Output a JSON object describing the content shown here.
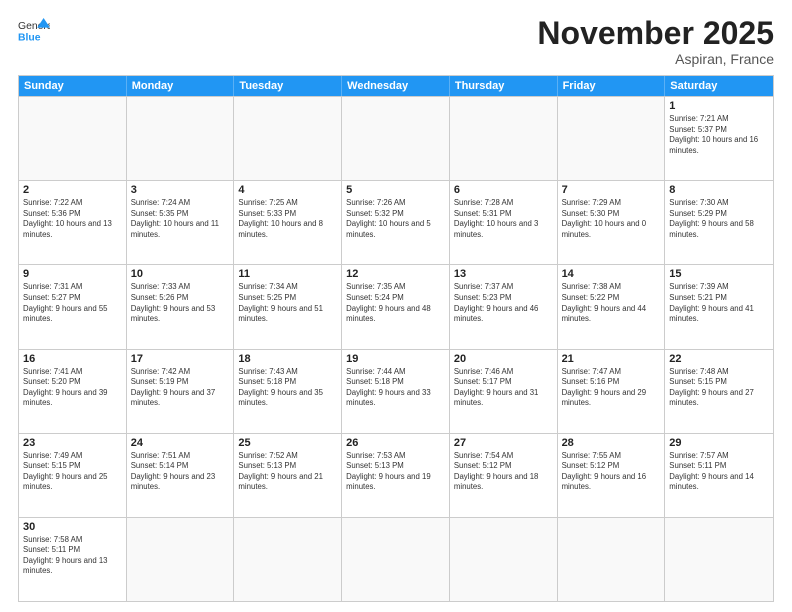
{
  "header": {
    "logo_general": "General",
    "logo_blue": "Blue",
    "month_title": "November 2025",
    "location": "Aspiran, France"
  },
  "days_of_week": [
    "Sunday",
    "Monday",
    "Tuesday",
    "Wednesday",
    "Thursday",
    "Friday",
    "Saturday"
  ],
  "weeks": [
    [
      {
        "day": "",
        "info": ""
      },
      {
        "day": "",
        "info": ""
      },
      {
        "day": "",
        "info": ""
      },
      {
        "day": "",
        "info": ""
      },
      {
        "day": "",
        "info": ""
      },
      {
        "day": "",
        "info": ""
      },
      {
        "day": "1",
        "info": "Sunrise: 7:21 AM\nSunset: 5:37 PM\nDaylight: 10 hours and 16 minutes."
      }
    ],
    [
      {
        "day": "2",
        "info": "Sunrise: 7:22 AM\nSunset: 5:36 PM\nDaylight: 10 hours and 13 minutes."
      },
      {
        "day": "3",
        "info": "Sunrise: 7:24 AM\nSunset: 5:35 PM\nDaylight: 10 hours and 11 minutes."
      },
      {
        "day": "4",
        "info": "Sunrise: 7:25 AM\nSunset: 5:33 PM\nDaylight: 10 hours and 8 minutes."
      },
      {
        "day": "5",
        "info": "Sunrise: 7:26 AM\nSunset: 5:32 PM\nDaylight: 10 hours and 5 minutes."
      },
      {
        "day": "6",
        "info": "Sunrise: 7:28 AM\nSunset: 5:31 PM\nDaylight: 10 hours and 3 minutes."
      },
      {
        "day": "7",
        "info": "Sunrise: 7:29 AM\nSunset: 5:30 PM\nDaylight: 10 hours and 0 minutes."
      },
      {
        "day": "8",
        "info": "Sunrise: 7:30 AM\nSunset: 5:29 PM\nDaylight: 9 hours and 58 minutes."
      }
    ],
    [
      {
        "day": "9",
        "info": "Sunrise: 7:31 AM\nSunset: 5:27 PM\nDaylight: 9 hours and 55 minutes."
      },
      {
        "day": "10",
        "info": "Sunrise: 7:33 AM\nSunset: 5:26 PM\nDaylight: 9 hours and 53 minutes."
      },
      {
        "day": "11",
        "info": "Sunrise: 7:34 AM\nSunset: 5:25 PM\nDaylight: 9 hours and 51 minutes."
      },
      {
        "day": "12",
        "info": "Sunrise: 7:35 AM\nSunset: 5:24 PM\nDaylight: 9 hours and 48 minutes."
      },
      {
        "day": "13",
        "info": "Sunrise: 7:37 AM\nSunset: 5:23 PM\nDaylight: 9 hours and 46 minutes."
      },
      {
        "day": "14",
        "info": "Sunrise: 7:38 AM\nSunset: 5:22 PM\nDaylight: 9 hours and 44 minutes."
      },
      {
        "day": "15",
        "info": "Sunrise: 7:39 AM\nSunset: 5:21 PM\nDaylight: 9 hours and 41 minutes."
      }
    ],
    [
      {
        "day": "16",
        "info": "Sunrise: 7:41 AM\nSunset: 5:20 PM\nDaylight: 9 hours and 39 minutes."
      },
      {
        "day": "17",
        "info": "Sunrise: 7:42 AM\nSunset: 5:19 PM\nDaylight: 9 hours and 37 minutes."
      },
      {
        "day": "18",
        "info": "Sunrise: 7:43 AM\nSunset: 5:18 PM\nDaylight: 9 hours and 35 minutes."
      },
      {
        "day": "19",
        "info": "Sunrise: 7:44 AM\nSunset: 5:18 PM\nDaylight: 9 hours and 33 minutes."
      },
      {
        "day": "20",
        "info": "Sunrise: 7:46 AM\nSunset: 5:17 PM\nDaylight: 9 hours and 31 minutes."
      },
      {
        "day": "21",
        "info": "Sunrise: 7:47 AM\nSunset: 5:16 PM\nDaylight: 9 hours and 29 minutes."
      },
      {
        "day": "22",
        "info": "Sunrise: 7:48 AM\nSunset: 5:15 PM\nDaylight: 9 hours and 27 minutes."
      }
    ],
    [
      {
        "day": "23",
        "info": "Sunrise: 7:49 AM\nSunset: 5:15 PM\nDaylight: 9 hours and 25 minutes."
      },
      {
        "day": "24",
        "info": "Sunrise: 7:51 AM\nSunset: 5:14 PM\nDaylight: 9 hours and 23 minutes."
      },
      {
        "day": "25",
        "info": "Sunrise: 7:52 AM\nSunset: 5:13 PM\nDaylight: 9 hours and 21 minutes."
      },
      {
        "day": "26",
        "info": "Sunrise: 7:53 AM\nSunset: 5:13 PM\nDaylight: 9 hours and 19 minutes."
      },
      {
        "day": "27",
        "info": "Sunrise: 7:54 AM\nSunset: 5:12 PM\nDaylight: 9 hours and 18 minutes."
      },
      {
        "day": "28",
        "info": "Sunrise: 7:55 AM\nSunset: 5:12 PM\nDaylight: 9 hours and 16 minutes."
      },
      {
        "day": "29",
        "info": "Sunrise: 7:57 AM\nSunset: 5:11 PM\nDaylight: 9 hours and 14 minutes."
      }
    ],
    [
      {
        "day": "30",
        "info": "Sunrise: 7:58 AM\nSunset: 5:11 PM\nDaylight: 9 hours and 13 minutes."
      },
      {
        "day": "",
        "info": ""
      },
      {
        "day": "",
        "info": ""
      },
      {
        "day": "",
        "info": ""
      },
      {
        "day": "",
        "info": ""
      },
      {
        "day": "",
        "info": ""
      },
      {
        "day": "",
        "info": ""
      }
    ]
  ]
}
